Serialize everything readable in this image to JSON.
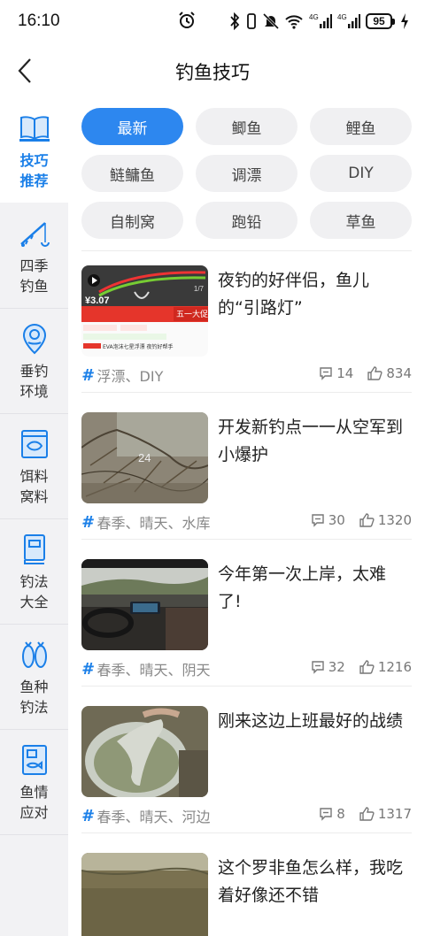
{
  "status_bar": {
    "time": "16:10",
    "battery": "95",
    "icons": [
      "alarm-icon",
      "bluetooth-icon",
      "vibrate-icon",
      "mute-icon",
      "wifi-icon",
      "signal-4g-icon",
      "signal-4g-icon",
      "charging-icon"
    ]
  },
  "header": {
    "title": "钓鱼技巧",
    "back_icon": "back-arrow-icon"
  },
  "sidebar": {
    "items": [
      {
        "label": "技巧推荐",
        "icon": "book-icon",
        "active": true
      },
      {
        "label": "四季钓鱼",
        "icon": "fishing-rod-icon",
        "active": false
      },
      {
        "label": "垂钓环境",
        "icon": "location-pin-icon",
        "active": false
      },
      {
        "label": "饵料窝料",
        "icon": "bait-icon",
        "active": false
      },
      {
        "label": "钓法大全",
        "icon": "manual-icon",
        "active": false
      },
      {
        "label": "鱼种钓法",
        "icon": "fish-species-icon",
        "active": false
      },
      {
        "label": "鱼情应对",
        "icon": "fish-report-icon",
        "active": false
      }
    ]
  },
  "chips": [
    "最新",
    "鲫鱼",
    "鲤鱼",
    "鲢鳙鱼",
    "调漂",
    "DIY",
    "自制窝",
    "跑铅",
    "草鱼"
  ],
  "articles": [
    {
      "title": "夜钓的好伴侣，鱼儿的“引路灯”",
      "tags": "浮漂、DIY",
      "comments": "14",
      "likes": "834"
    },
    {
      "title": "开发新钓点一一从空军到小爆护",
      "tags": "春季、晴天、水库",
      "comments": "30",
      "likes": "1320"
    },
    {
      "title": "今年第一次上岸，太难了!",
      "tags": "春季、晴天、阴天",
      "comments": "32",
      "likes": "1216"
    },
    {
      "title": "刚来这边上班最好的战绩",
      "tags": "春季、晴天、河边",
      "comments": "8",
      "likes": "1317"
    },
    {
      "title": "这个罗非鱼怎么样，我吃着好像还不错",
      "tags": "",
      "comments": "",
      "likes": ""
    }
  ],
  "thumb1": {
    "price_text": "¥3.07",
    "banner_text": "五一大促",
    "caption": "EVA泡沫七星浮漂 夜钓好帮手",
    "counter": "1/7"
  },
  "thumb2": {
    "counter": "24"
  },
  "colors": {
    "accent": "#2d87ef",
    "sidebar_bg": "#f2f2f4",
    "chip_bg": "#f0f0f2"
  }
}
